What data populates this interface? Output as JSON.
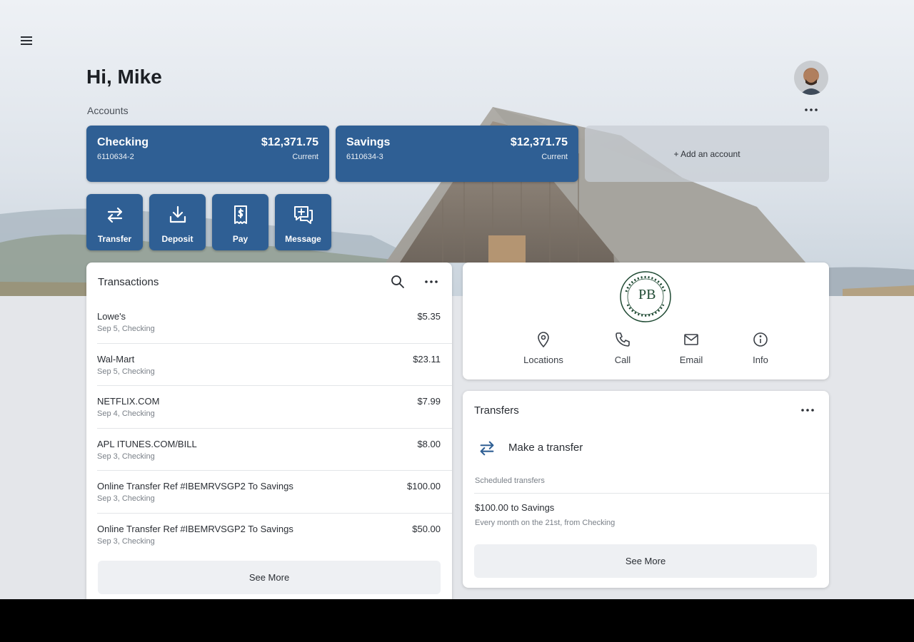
{
  "header": {
    "menu_icon": "hamburger-menu-icon",
    "greeting": "Hi, Mike",
    "avatar_icon": "user-avatar"
  },
  "accounts": {
    "label": "Accounts",
    "more_icon": "more-horizontal-icon",
    "items": [
      {
        "name": "Checking",
        "number": "6110634-2",
        "balance": "$12,371.75",
        "status": "Current"
      },
      {
        "name": "Savings",
        "number": "6110634-3",
        "balance": "$12,371.75",
        "status": "Current"
      }
    ],
    "add_label": "+ Add an account"
  },
  "actions": [
    {
      "label": "Transfer",
      "icon": "transfer-arrows-icon"
    },
    {
      "label": "Deposit",
      "icon": "download-deposit-icon"
    },
    {
      "label": "Pay",
      "icon": "bill-pay-icon"
    },
    {
      "label": "Message",
      "icon": "message-add-icon"
    }
  ],
  "transactions": {
    "title": "Transactions",
    "search_icon": "search-icon",
    "more_icon": "more-horizontal-icon",
    "items": [
      {
        "merchant": "Lowe's",
        "detail": "Sep 5, Checking",
        "amount": "$5.35"
      },
      {
        "merchant": "Wal-Mart",
        "detail": "Sep 5, Checking",
        "amount": "$23.11"
      },
      {
        "merchant": "NETFLIX.COM",
        "detail": "Sep 4, Checking",
        "amount": "$7.99"
      },
      {
        "merchant": "APL ITUNES.COM/BILL",
        "detail": "Sep 3, Checking",
        "amount": "$8.00"
      },
      {
        "merchant": "Online Transfer Ref #IBEMRVSGP2 To Savings",
        "detail": "Sep 3, Checking",
        "amount": "$100.00"
      },
      {
        "merchant": "Online Transfer Ref #IBEMRVSGP2 To Savings",
        "detail": "Sep 3, Checking",
        "amount": "$50.00"
      }
    ],
    "see_more": "See More"
  },
  "bank": {
    "logo_initials": "PB",
    "logo_ring_text": "PEOPLES BANK OF DEER LODGE",
    "contacts": [
      {
        "label": "Locations",
        "icon": "location-pin-icon"
      },
      {
        "label": "Call",
        "icon": "phone-icon"
      },
      {
        "label": "Email",
        "icon": "email-icon"
      },
      {
        "label": "Info",
        "icon": "info-icon"
      }
    ]
  },
  "transfers": {
    "title": "Transfers",
    "more_icon": "more-horizontal-icon",
    "make_transfer": "Make a transfer",
    "scheduled_label": "Scheduled transfers",
    "scheduled": [
      {
        "title": "$100.00 to Savings",
        "subtitle": "Every month on the 21st, from Checking"
      }
    ],
    "see_more": "See More"
  },
  "colors": {
    "accent": "#2f5f94",
    "page_bg": "#e4e6ea",
    "card_bg": "#ffffff"
  }
}
